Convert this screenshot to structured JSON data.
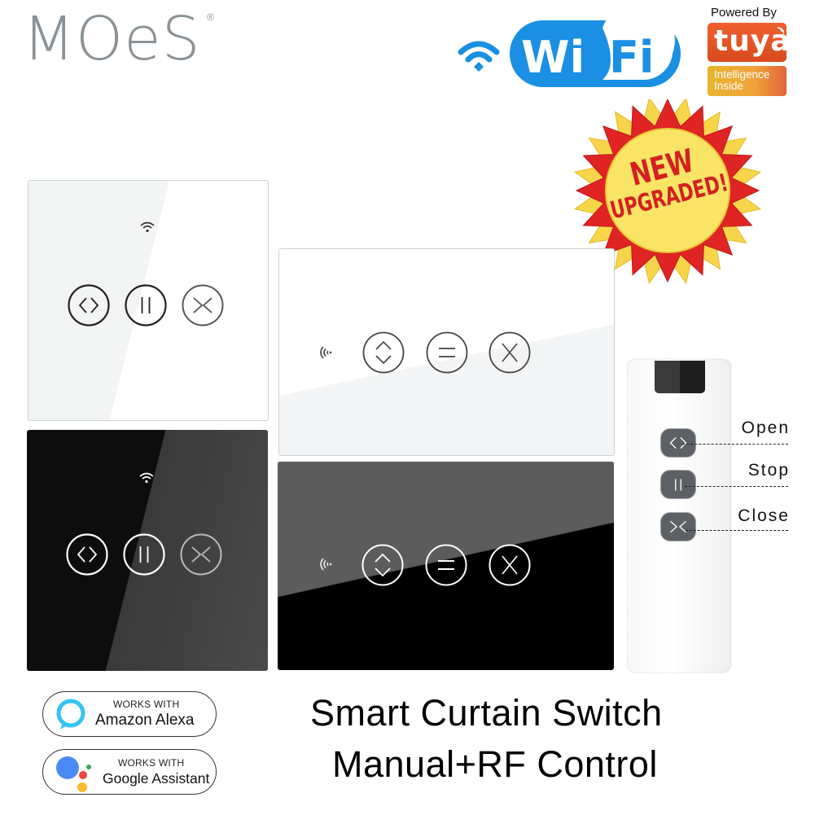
{
  "brand": {
    "logo": "MOeS",
    "registered_mark": "®"
  },
  "wifi_badge": {
    "text_left": "Wi",
    "text_right": "Fi",
    "color": "#1a8fe3"
  },
  "tuya": {
    "powered_by": "Powered By",
    "name": "tuya",
    "tagline_line1": "Intelligence",
    "tagline_line2": "Inside",
    "color": "#e5552a"
  },
  "promo_badge": {
    "line1": "NEW",
    "line2": "UPGRADED!",
    "colors": {
      "burst_outer": "#e02424",
      "burst_inner": "#f7d54a",
      "text": "#d42020"
    }
  },
  "panels": [
    {
      "name": "white-square-panel",
      "buttons": [
        "open",
        "stop",
        "close"
      ],
      "indicator": "wifi-icon"
    },
    {
      "name": "black-square-panel",
      "buttons": [
        "open",
        "stop",
        "close"
      ],
      "indicator": "wifi-icon"
    },
    {
      "name": "white-landscape-panel",
      "buttons": [
        "up-down",
        "stop",
        "close"
      ],
      "indicator": "rf-signal-icon"
    },
    {
      "name": "black-landscape-panel",
      "buttons": [
        "up-down",
        "stop",
        "close"
      ],
      "indicator": "rf-signal-icon"
    }
  ],
  "remote": {
    "buttons": [
      {
        "label": "Open",
        "icon": "open-icon"
      },
      {
        "label": "Stop",
        "icon": "pause-icon"
      },
      {
        "label": "Close",
        "icon": "close-icon"
      }
    ]
  },
  "compat": [
    {
      "works_with": "WORKS WITH",
      "name": "Amazon Alexa"
    },
    {
      "works_with": "WORKS WITH",
      "name": "Google Assistant"
    }
  ],
  "title": {
    "line1": "Smart Curtain Switch",
    "line2": "Manual+RF Control"
  }
}
